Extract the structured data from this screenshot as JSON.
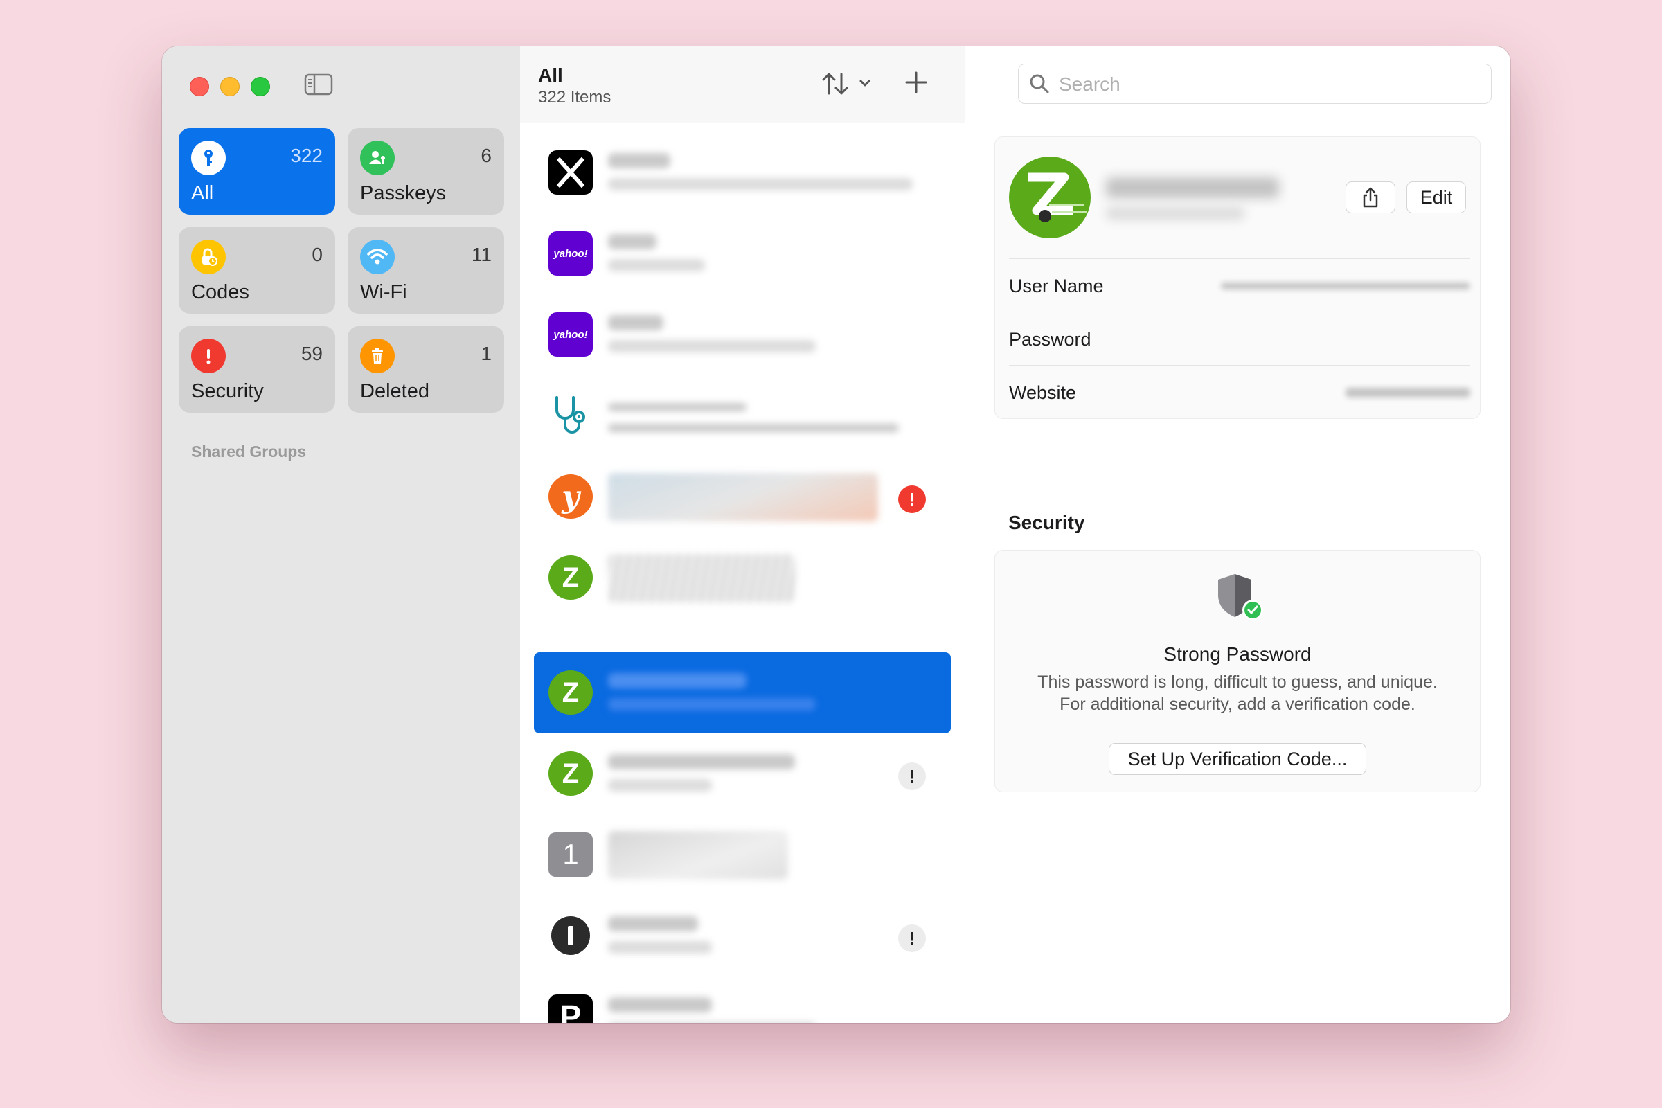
{
  "sidebar": {
    "tiles": [
      {
        "label": "All",
        "count": "322",
        "icon": "key-icon",
        "color": "#0a72ea"
      },
      {
        "label": "Passkeys",
        "count": "6",
        "icon": "person-key-icon",
        "color": "#30c15a"
      },
      {
        "label": "Codes",
        "count": "0",
        "icon": "lock-clock-icon",
        "color": "#ffc400"
      },
      {
        "label": "Wi-Fi",
        "count": "11",
        "icon": "wifi-icon",
        "color": "#4fb8f5"
      },
      {
        "label": "Security",
        "count": "59",
        "icon": "exclamation-icon",
        "color": "#f03a30"
      },
      {
        "label": "Deleted",
        "count": "1",
        "icon": "trash-icon",
        "color": "#ff9500"
      }
    ],
    "shared_groups_label": "Shared Groups"
  },
  "list": {
    "title": "All",
    "subtitle": "322 Items",
    "items": [
      {
        "logo": "x-logo-icon"
      },
      {
        "logo": "yahoo-logo-icon",
        "logo_text": "yahoo!"
      },
      {
        "logo": "yahoo-logo-icon",
        "logo_text": "yahoo!"
      },
      {
        "logo": "stethoscope-icon"
      },
      {
        "logo": "y-logo-icon",
        "logo_text": "y",
        "alert": "red"
      },
      {
        "logo": "zipcar-logo-icon",
        "logo_text": "Z"
      },
      {
        "logo": "zipcar-logo-icon",
        "logo_text": "Z",
        "selected": true
      },
      {
        "logo": "zipcar-logo-icon",
        "logo_text": "Z",
        "alert": "gray"
      },
      {
        "logo": "one-logo-icon",
        "logo_text": "1"
      },
      {
        "logo": "keyhole-logo-icon",
        "alert": "gray"
      },
      {
        "logo": "p-logo-icon",
        "logo_text": "P"
      }
    ]
  },
  "detail": {
    "search_placeholder": "Search",
    "edit_label": "Edit",
    "fields": [
      {
        "label": "User Name"
      },
      {
        "label": "Password"
      },
      {
        "label": "Website"
      }
    ],
    "security": {
      "heading": "Security",
      "title": "Strong Password",
      "desc_line1": "This password is long, difficult to guess, and unique.",
      "desc_line2": "For additional security, add a verification code.",
      "button": "Set Up Verification Code..."
    }
  },
  "colors": {
    "accent": "#0a72ea",
    "zipcar": "#5aaa19",
    "yahoo": "#6001d2",
    "alert_red": "#f03a30",
    "background": "#f8d9e1"
  }
}
